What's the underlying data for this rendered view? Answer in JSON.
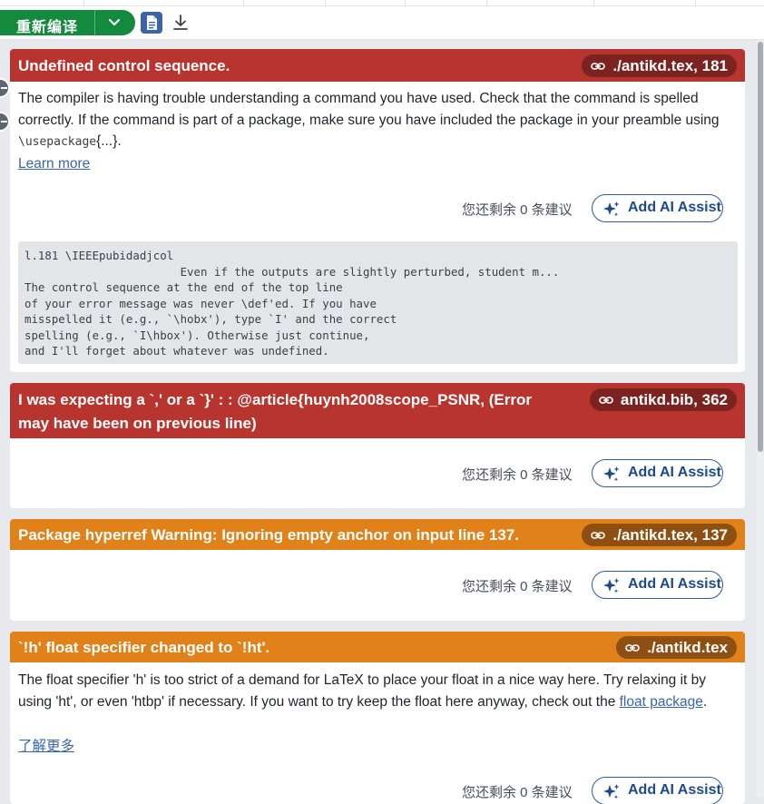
{
  "toolbar": {
    "compile_label": "重新编译"
  },
  "logs": [
    {
      "level": "error",
      "title": "Undefined control sequence.",
      "location": "./antikd.tex, 181",
      "description_parts": [
        "The compiler is having trouble understanding a command you have used. Check that the command is spelled correctly. If the command is part of a package, make sure you have included the package in your preamble using ",
        "\\usepackage",
        "{...}."
      ],
      "learn_more": "Learn more",
      "remaining": "您还剩余 0 条建议",
      "ai_assist": "Add AI Assist",
      "raw_lines": [
        "l.181 \\IEEEpubidadjcol",
        "                       Even if the outputs are slightly perturbed, student m...",
        "The control sequence at the end of the top line",
        "of your error message was never \\def'ed. If you have",
        "misspelled it (e.g., `\\hobx'), type `I' and the correct",
        "spelling (e.g., `I\\hbox'). Otherwise just continue,",
        "and I'll forget about whatever was undefined."
      ]
    },
    {
      "level": "error",
      "title_line1": "I was expecting a `,' or a `}' : : @article{huynh2008scope_PSNR, (Error",
      "title_line2": "may have been on previous line)",
      "location": "antikd.bib, 362",
      "remaining": "您还剩余 0 条建议",
      "ai_assist": "Add AI Assist"
    },
    {
      "level": "warning",
      "title": "Package hyperref Warning: Ignoring empty anchor on input line 137.",
      "location": "./antikd.tex, 137",
      "remaining": "您还剩余 0 条建议",
      "ai_assist": "Add AI Assist"
    },
    {
      "level": "warning",
      "title": "`!h' float specifier changed to `!ht'.",
      "location": "./antikd.tex",
      "description_parts": [
        "The float specifier 'h' is too strict of a demand for LaTeX to place your float in a nice way here. Try relaxing it by using 'ht', or even 'htbp' if necessary. If you want to try keep the float here anyway, check out the ",
        "float package",
        "."
      ],
      "learn_more": "了解更多",
      "remaining": "您还剩余 0 条建议",
      "ai_assist": "Add AI Assist"
    }
  ],
  "colors": {
    "error_header": "#b8342f",
    "warning_header": "#e0811a",
    "compile_green": "#138a3d",
    "link_blue": "#3965a8"
  },
  "icons": [
    "chevron-down-icon",
    "document-icon",
    "download-icon",
    "link-icon",
    "sparkle-icon"
  ]
}
